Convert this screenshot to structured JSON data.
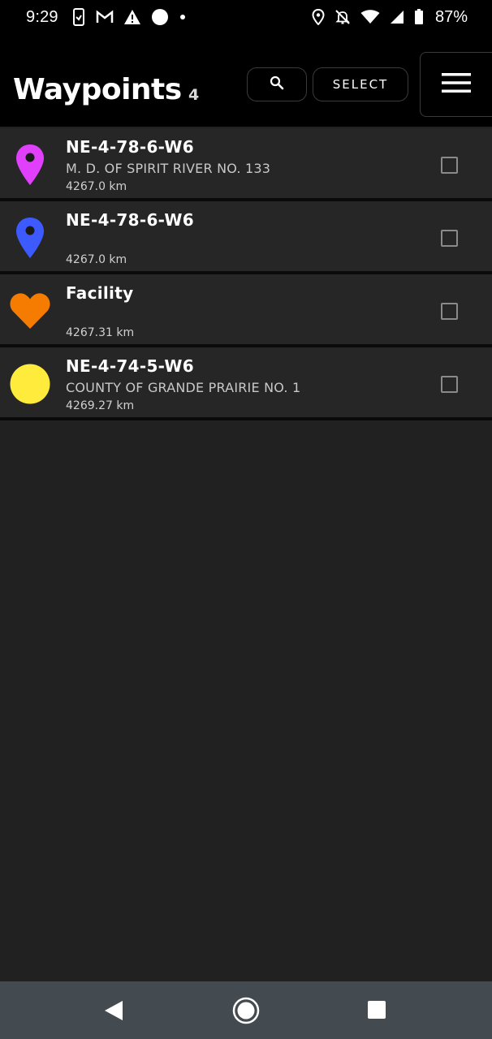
{
  "status_bar": {
    "time": "9:29",
    "battery_percent": "87%",
    "left_icons": [
      "phone-link-icon",
      "gmail-icon",
      "warning-icon",
      "circle-icon",
      "dot-icon"
    ],
    "right_icons": [
      "location-icon",
      "bell-off-icon",
      "wifi-icon",
      "signal-icon",
      "battery-icon"
    ]
  },
  "header": {
    "title": "Waypoints",
    "count": "4",
    "search_icon": "search-icon",
    "select_label": "SELECT",
    "menu_icon": "hamburger-menu-icon"
  },
  "waypoints": [
    {
      "name": "NE-4-78-6-W6",
      "area": "M. D. OF SPIRIT RIVER NO. 133",
      "distance": "4267.0 km",
      "icon": "pin-icon",
      "color": "#e040fb",
      "checked": false
    },
    {
      "name": "NE-4-78-6-W6",
      "area": "",
      "distance": "4267.0 km",
      "icon": "pin-icon",
      "color": "#3d5afe",
      "checked": false
    },
    {
      "name": "Facility",
      "area": "",
      "distance": "4267.31 km",
      "icon": "heart-icon",
      "color": "#f57c00",
      "checked": false
    },
    {
      "name": "NE-4-74-5-W6",
      "area": "COUNTY OF GRANDE PRAIRIE NO. 1",
      "distance": "4269.27 km",
      "icon": "circle-icon",
      "color": "#ffeb3b",
      "checked": false
    }
  ],
  "nav_bar": {
    "back_icon": "back-triangle-icon",
    "home_icon": "home-circle-icon",
    "recents_icon": "recents-square-icon"
  },
  "colors": {
    "background": "#212121",
    "row_background": "#262626",
    "header_background": "#000000",
    "nav_background": "#444b50"
  }
}
